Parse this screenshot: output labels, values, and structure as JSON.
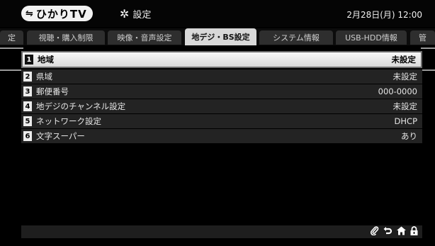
{
  "header": {
    "logo_text": "ひかりTV",
    "logo_mark": "⇋",
    "title": "設定",
    "gear_icon": "gear-icon",
    "datetime": "2月28日(月) 12:00"
  },
  "tabs": [
    {
      "label": "定"
    },
    {
      "label": "視聴・購入制限"
    },
    {
      "label": "映像・音声設定"
    },
    {
      "label": "地デジ・BS設定",
      "active": true
    },
    {
      "label": "システム情報"
    },
    {
      "label": "USB-HDD情報"
    },
    {
      "label": "管"
    }
  ],
  "settings": [
    {
      "num": "1",
      "label": "地域",
      "value": "未設定"
    },
    {
      "num": "2",
      "label": "県域",
      "value": "未設定"
    },
    {
      "num": "3",
      "label": "郵便番号",
      "value": "000-0000"
    },
    {
      "num": "4",
      "label": "地デジのチャンネル設定",
      "value": "未設定"
    },
    {
      "num": "5",
      "label": "ネットワーク設定",
      "value": "DHCP"
    },
    {
      "num": "6",
      "label": "文字スーパー",
      "value": "あり"
    }
  ],
  "footer_icons": [
    {
      "name": "paperclip-icon",
      "glyph": "⌀"
    },
    {
      "name": "return-icon",
      "glyph": "↩"
    },
    {
      "name": "home-icon",
      "glyph": "⌂"
    },
    {
      "name": "lock-icon",
      "glyph": "🔒"
    }
  ]
}
